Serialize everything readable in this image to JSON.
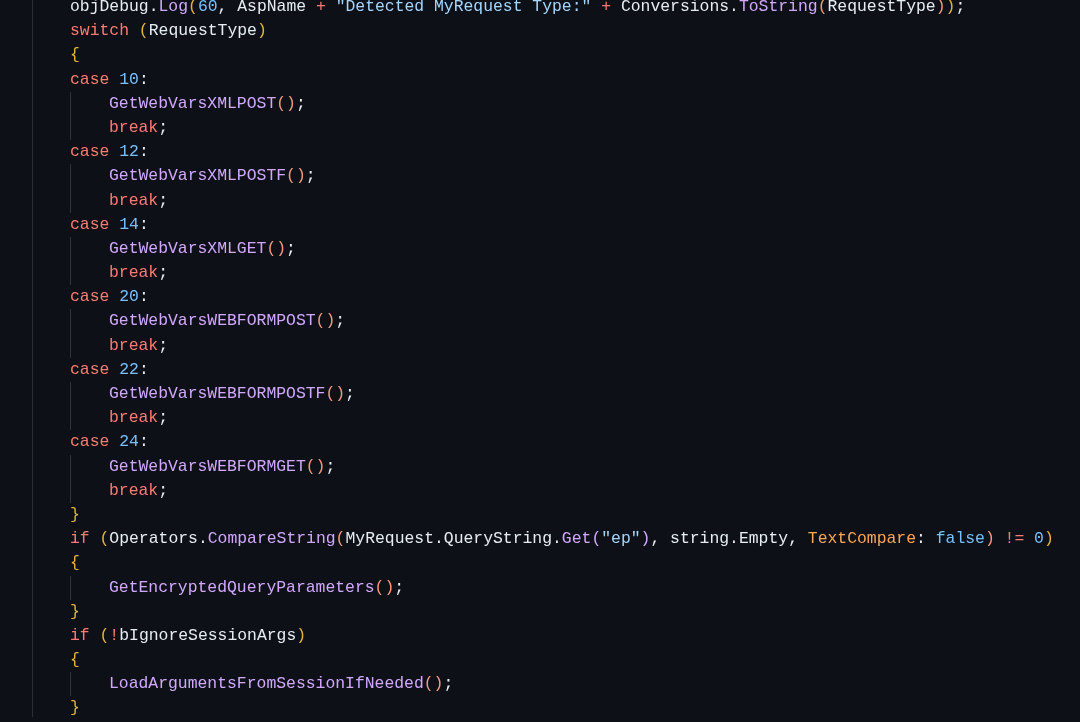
{
  "editor": {
    "lines": [
      {
        "indented": false,
        "tokens": [
          {
            "kind": "plain",
            "text": "objDebug."
          },
          {
            "kind": "function",
            "text": "Log"
          },
          {
            "kind": "bracket",
            "text": "("
          },
          {
            "kind": "number",
            "text": "60"
          },
          {
            "kind": "plain",
            "text": ", AspName "
          },
          {
            "kind": "operator",
            "text": "+ "
          },
          {
            "kind": "string",
            "text": "\"Detected MyRequest Type:\" "
          },
          {
            "kind": "operator",
            "text": "+"
          },
          {
            "kind": "plain",
            "text": " Conversions."
          },
          {
            "kind": "function",
            "text": "ToString"
          },
          {
            "kind": "bracket2",
            "text": "("
          },
          {
            "kind": "plain",
            "text": "RequestType"
          },
          {
            "kind": "bracket2",
            "text": ")"
          },
          {
            "kind": "bracket",
            "text": ")"
          },
          {
            "kind": "plain",
            "text": ";"
          }
        ]
      },
      {
        "indented": false,
        "tokens": [
          {
            "kind": "keyword",
            "text": "switch "
          },
          {
            "kind": "bracket",
            "text": "("
          },
          {
            "kind": "plain",
            "text": "RequestType"
          },
          {
            "kind": "bracket",
            "text": ")"
          }
        ]
      },
      {
        "indented": false,
        "tokens": [
          {
            "kind": "bracket",
            "text": "{"
          }
        ]
      },
      {
        "indented": false,
        "tokens": [
          {
            "kind": "keyword",
            "text": "case "
          },
          {
            "kind": "number",
            "text": "10"
          },
          {
            "kind": "plain",
            "text": ":"
          }
        ]
      },
      {
        "indented": true,
        "tokens": [
          {
            "kind": "function",
            "text": "GetWebVarsXMLPOST"
          },
          {
            "kind": "bracket2",
            "text": "()"
          },
          {
            "kind": "plain",
            "text": ";"
          }
        ]
      },
      {
        "indented": true,
        "tokens": [
          {
            "kind": "keyword",
            "text": "break"
          },
          {
            "kind": "plain",
            "text": ";"
          }
        ]
      },
      {
        "indented": false,
        "tokens": [
          {
            "kind": "keyword",
            "text": "case "
          },
          {
            "kind": "number",
            "text": "12"
          },
          {
            "kind": "plain",
            "text": ":"
          }
        ]
      },
      {
        "indented": true,
        "tokens": [
          {
            "kind": "function",
            "text": "GetWebVarsXMLPOSTF"
          },
          {
            "kind": "bracket2",
            "text": "()"
          },
          {
            "kind": "plain",
            "text": ";"
          }
        ]
      },
      {
        "indented": true,
        "tokens": [
          {
            "kind": "keyword",
            "text": "break"
          },
          {
            "kind": "plain",
            "text": ";"
          }
        ]
      },
      {
        "indented": false,
        "tokens": [
          {
            "kind": "keyword",
            "text": "case "
          },
          {
            "kind": "number",
            "text": "14"
          },
          {
            "kind": "plain",
            "text": ":"
          }
        ]
      },
      {
        "indented": true,
        "tokens": [
          {
            "kind": "function",
            "text": "GetWebVarsXMLGET"
          },
          {
            "kind": "bracket2",
            "text": "()"
          },
          {
            "kind": "plain",
            "text": ";"
          }
        ]
      },
      {
        "indented": true,
        "tokens": [
          {
            "kind": "keyword",
            "text": "break"
          },
          {
            "kind": "plain",
            "text": ";"
          }
        ]
      },
      {
        "indented": false,
        "tokens": [
          {
            "kind": "keyword",
            "text": "case "
          },
          {
            "kind": "number",
            "text": "20"
          },
          {
            "kind": "plain",
            "text": ":"
          }
        ]
      },
      {
        "indented": true,
        "tokens": [
          {
            "kind": "function",
            "text": "GetWebVarsWEBFORMPOST"
          },
          {
            "kind": "bracket2",
            "text": "()"
          },
          {
            "kind": "plain",
            "text": ";"
          }
        ]
      },
      {
        "indented": true,
        "tokens": [
          {
            "kind": "keyword",
            "text": "break"
          },
          {
            "kind": "plain",
            "text": ";"
          }
        ]
      },
      {
        "indented": false,
        "tokens": [
          {
            "kind": "keyword",
            "text": "case "
          },
          {
            "kind": "number",
            "text": "22"
          },
          {
            "kind": "plain",
            "text": ":"
          }
        ]
      },
      {
        "indented": true,
        "tokens": [
          {
            "kind": "function",
            "text": "GetWebVarsWEBFORMPOSTF"
          },
          {
            "kind": "bracket2",
            "text": "()"
          },
          {
            "kind": "plain",
            "text": ";"
          }
        ]
      },
      {
        "indented": true,
        "tokens": [
          {
            "kind": "keyword",
            "text": "break"
          },
          {
            "kind": "plain",
            "text": ";"
          }
        ]
      },
      {
        "indented": false,
        "tokens": [
          {
            "kind": "keyword",
            "text": "case "
          },
          {
            "kind": "number",
            "text": "24"
          },
          {
            "kind": "plain",
            "text": ":"
          }
        ]
      },
      {
        "indented": true,
        "tokens": [
          {
            "kind": "function",
            "text": "GetWebVarsWEBFORMGET"
          },
          {
            "kind": "bracket2",
            "text": "()"
          },
          {
            "kind": "plain",
            "text": ";"
          }
        ]
      },
      {
        "indented": true,
        "tokens": [
          {
            "kind": "keyword",
            "text": "break"
          },
          {
            "kind": "plain",
            "text": ";"
          }
        ]
      },
      {
        "indented": false,
        "tokens": [
          {
            "kind": "bracket",
            "text": "}"
          }
        ]
      },
      {
        "indented": false,
        "tokens": [
          {
            "kind": "keyword",
            "text": "if "
          },
          {
            "kind": "bracket",
            "text": "("
          },
          {
            "kind": "plain",
            "text": "Operators."
          },
          {
            "kind": "function",
            "text": "CompareString"
          },
          {
            "kind": "bracket2",
            "text": "("
          },
          {
            "kind": "plain",
            "text": "MyRequest.QueryString."
          },
          {
            "kind": "function",
            "text": "Get"
          },
          {
            "kind": "bracket3",
            "text": "("
          },
          {
            "kind": "string",
            "text": "\"ep\""
          },
          {
            "kind": "bracket3",
            "text": ")"
          },
          {
            "kind": "plain",
            "text": ", string.Empty, "
          },
          {
            "kind": "param",
            "text": "TextCompare"
          },
          {
            "kind": "plain",
            "text": ": "
          },
          {
            "kind": "number",
            "text": "false"
          },
          {
            "kind": "bracket2",
            "text": ") "
          },
          {
            "kind": "operator",
            "text": "!= "
          },
          {
            "kind": "number",
            "text": "0"
          },
          {
            "kind": "bracket",
            "text": ")"
          }
        ]
      },
      {
        "indented": false,
        "tokens": [
          {
            "kind": "bracket",
            "text": "{"
          }
        ]
      },
      {
        "indented": true,
        "tokens": [
          {
            "kind": "function",
            "text": "GetEncryptedQueryParameters"
          },
          {
            "kind": "bracket2",
            "text": "()"
          },
          {
            "kind": "plain",
            "text": ";"
          }
        ]
      },
      {
        "indented": false,
        "tokens": [
          {
            "kind": "bracket",
            "text": "}"
          }
        ]
      },
      {
        "indented": false,
        "tokens": [
          {
            "kind": "keyword",
            "text": "if "
          },
          {
            "kind": "bracket",
            "text": "("
          },
          {
            "kind": "operator",
            "text": "!"
          },
          {
            "kind": "plain",
            "text": "bIgnoreSessionArgs"
          },
          {
            "kind": "bracket",
            "text": ")"
          }
        ]
      },
      {
        "indented": false,
        "tokens": [
          {
            "kind": "bracket",
            "text": "{"
          }
        ]
      },
      {
        "indented": true,
        "tokens": [
          {
            "kind": "function",
            "text": "LoadArgumentsFromSessionIfNeeded"
          },
          {
            "kind": "bracket2",
            "text": "()"
          },
          {
            "kind": "plain",
            "text": ";"
          }
        ]
      },
      {
        "indented": false,
        "tokens": [
          {
            "kind": "bracket",
            "text": "}"
          }
        ]
      }
    ]
  }
}
